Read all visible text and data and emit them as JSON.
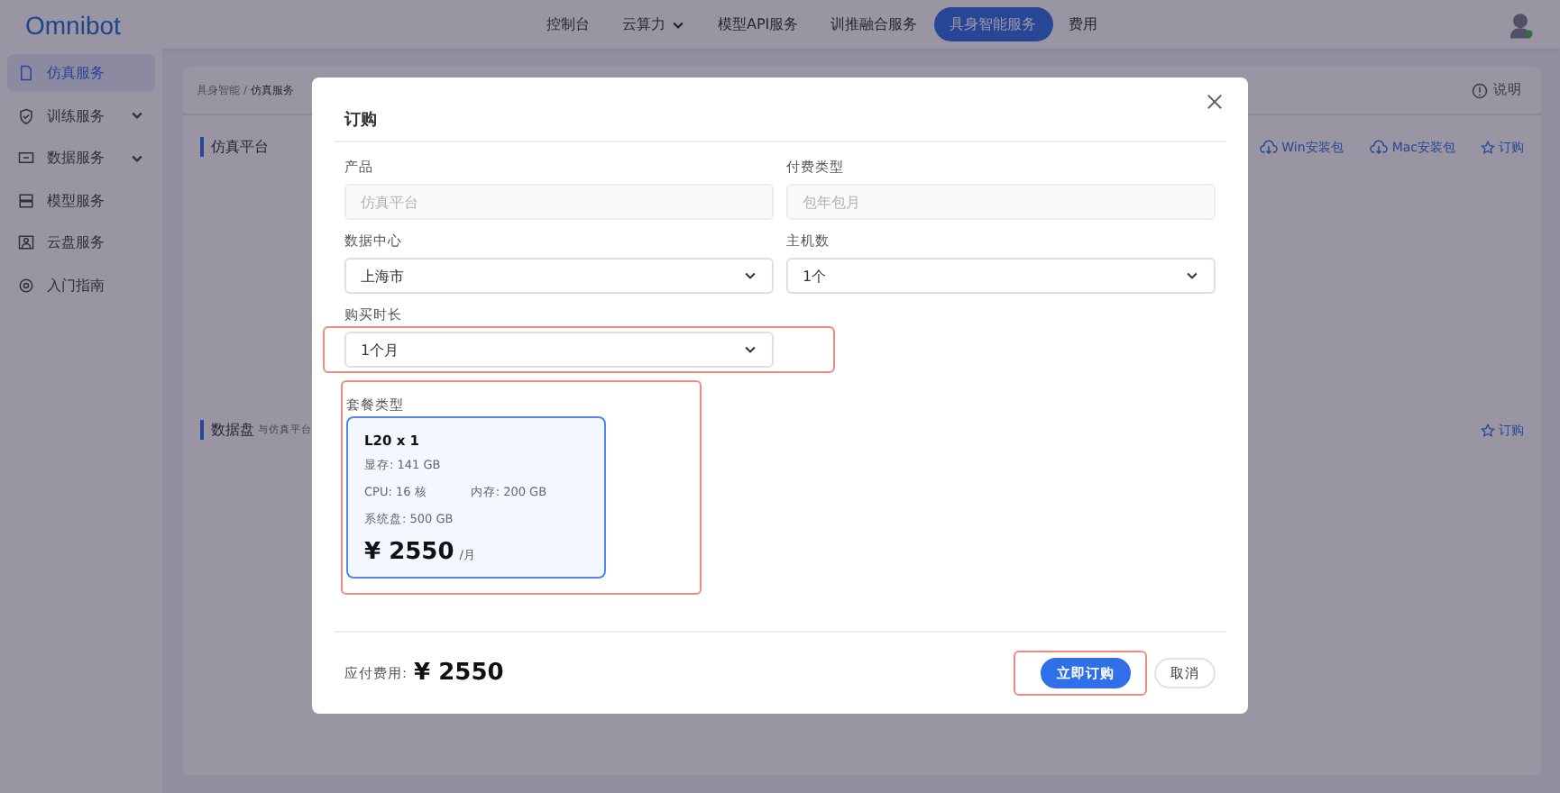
{
  "app": {
    "logo": "Omnibot"
  },
  "nav": [
    {
      "label": "控制台",
      "selected": false,
      "dropdown": false
    },
    {
      "label": "云算力",
      "selected": false,
      "dropdown": true
    },
    {
      "label": "模型API服务",
      "selected": false,
      "dropdown": false
    },
    {
      "label": "训推融合服务",
      "selected": false,
      "dropdown": false
    },
    {
      "label": "具身智能服务",
      "selected": true,
      "dropdown": false
    },
    {
      "label": "费用",
      "selected": false,
      "dropdown": false
    }
  ],
  "sidebar": [
    {
      "label": "仿真服务",
      "selected": true,
      "expandable": false
    },
    {
      "label": "训练服务",
      "selected": false,
      "expandable": true
    },
    {
      "label": "数据服务",
      "selected": false,
      "expandable": true
    },
    {
      "label": "模型服务",
      "selected": false,
      "expandable": false
    },
    {
      "label": "云盘服务",
      "selected": false,
      "expandable": false
    },
    {
      "label": "入门指南",
      "selected": false,
      "expandable": false
    }
  ],
  "breadcrumb": [
    "具身智能",
    "仿真服务"
  ],
  "breadcrumb_separator": "/",
  "help": "说明",
  "sections": [
    {
      "title": "仿真平台",
      "actions": [
        {
          "label": "Win安装包",
          "kind": "download"
        },
        {
          "label": "Mac安装包",
          "kind": "download"
        },
        {
          "label": "订购",
          "kind": "order"
        }
      ]
    },
    {
      "title": "数据盘",
      "subtitle": "与仿真平台",
      "actions": [
        {
          "label": "订购",
          "kind": "order"
        }
      ]
    }
  ],
  "dialog": {
    "title": "订购",
    "fields": [
      {
        "label": "产品",
        "kind": "text",
        "placeholder": "仿真平台",
        "disabled": true,
        "highlighted": false
      },
      {
        "label": "付费类型",
        "kind": "text",
        "placeholder": "包年包月",
        "disabled": true,
        "highlighted": false
      },
      {
        "label": "数据中心",
        "kind": "select",
        "value": "上海市",
        "disabled": false,
        "highlighted": false
      },
      {
        "label": "主机数",
        "kind": "select",
        "value": "1个",
        "disabled": false,
        "highlighted": false
      },
      {
        "label": "购买时长",
        "kind": "select",
        "value": "1个月",
        "disabled": false,
        "highlighted": true
      }
    ],
    "package": {
      "label": "套餐类型",
      "highlighted": true,
      "options": [
        {
          "name": "L20 x 1",
          "specs": [
            [
              "显存: 141 GB"
            ],
            [
              "CPU: 16 核",
              "内存: 200 GB"
            ],
            [
              "系统盘: 500 GB"
            ]
          ],
          "price": "¥ 2550",
          "unit": "/月",
          "selected": true
        }
      ]
    },
    "total_label": "应付费用:",
    "total": "¥ 2550",
    "buttons": [
      {
        "label": "立即订购",
        "kind": "primary",
        "highlighted": true
      },
      {
        "label": "取消",
        "kind": "default",
        "highlighted": false
      }
    ]
  }
}
